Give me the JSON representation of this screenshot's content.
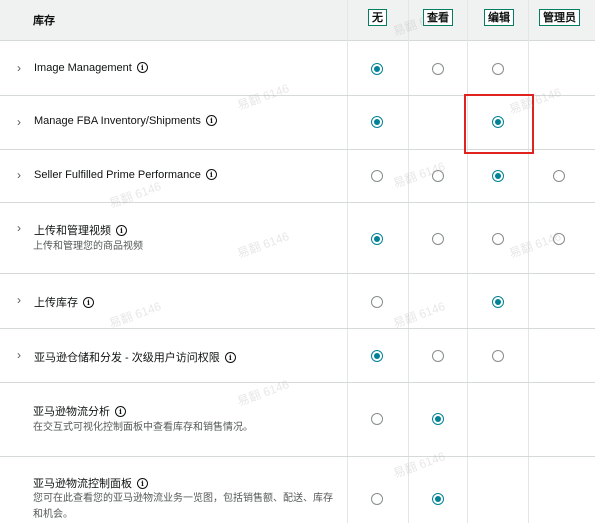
{
  "header": {
    "title": "库存",
    "columns": [
      "无",
      "查看",
      "编辑",
      "管理员"
    ]
  },
  "rows": [
    {
      "label": "Image Management",
      "desc": "",
      "expandable": true,
      "radios": [
        "on",
        "off",
        "off",
        null
      ]
    },
    {
      "label": "Manage FBA Inventory/Shipments",
      "desc": "",
      "expandable": true,
      "radios": [
        "on",
        null,
        "on",
        null
      ]
    },
    {
      "label": "Seller Fulfilled Prime Performance",
      "desc": "",
      "expandable": true,
      "radios": [
        "off",
        "off",
        "on",
        "off"
      ]
    },
    {
      "label": "上传和管理视频",
      "desc": "上传和管理您的商品视频",
      "expandable": true,
      "radios": [
        "on",
        "off",
        "off",
        "off"
      ]
    },
    {
      "label": "上传库存",
      "desc": "",
      "expandable": true,
      "radios": [
        "off",
        null,
        "on",
        null
      ]
    },
    {
      "label": "亚马逊仓储和分发 - 次级用户访问权限",
      "desc": "",
      "expandable": true,
      "radios": [
        "on",
        "off",
        "off",
        null
      ]
    },
    {
      "label": "亚马逊物流分析",
      "desc": "在交互式可视化控制面板中查看库存和销售情况。",
      "expandable": false,
      "radios": [
        "off",
        "on",
        null,
        null
      ]
    },
    {
      "label": "亚马逊物流控制面板",
      "desc": "您可在此查看您的亚马逊物流业务一览图，包括销售额、配送、库存和机会。",
      "expandable": false,
      "radios": [
        "off",
        "on",
        null,
        null
      ]
    }
  ],
  "watermark": "易翻 6146",
  "colors": {
    "accent": "#008296",
    "highlight": "#e0231f"
  }
}
